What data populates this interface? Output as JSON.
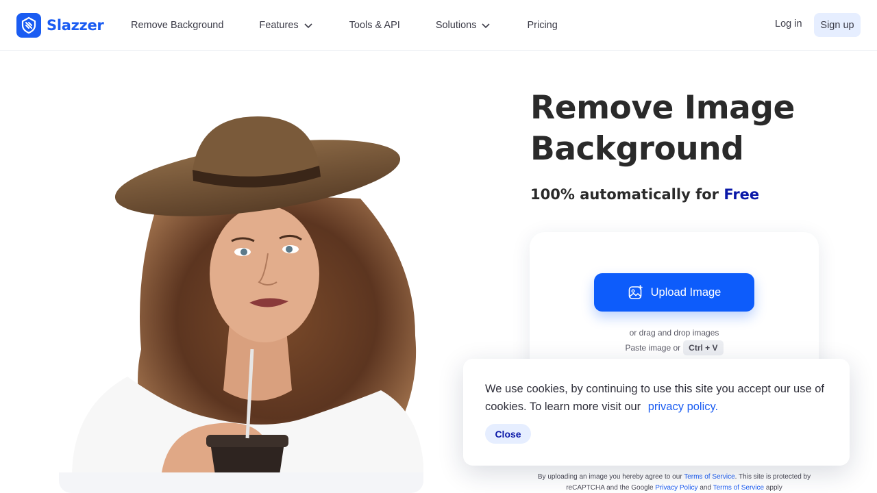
{
  "header": {
    "brand": "Slazzer",
    "nav": [
      {
        "label": "Remove Background",
        "dropdown": false
      },
      {
        "label": "Features",
        "dropdown": true
      },
      {
        "label": "Tools & API",
        "dropdown": false
      },
      {
        "label": "Solutions",
        "dropdown": true
      },
      {
        "label": "Pricing",
        "dropdown": false
      }
    ],
    "login_label": "Log in",
    "signup_label": "Sign up"
  },
  "hero": {
    "title_line1": "Remove Image",
    "title_line2": "Background",
    "subtitle_prefix": "100% automatically for",
    "subtitle_accent": "Free"
  },
  "upload": {
    "button_label": "Upload Image",
    "drag_text": "or drag and drop images",
    "paste_text": "Paste image or",
    "paste_shortcut": "Ctrl + V"
  },
  "legal": {
    "part1": "By uploading an image you hereby agree to our",
    "terms_link": "Terms of Service",
    "part2": ". This site is protected by reCAPTCHA and the Google",
    "privacy_link": "Privacy Policy",
    "part3": "and",
    "terms_link2": "Terms of Service",
    "part4": "apply"
  },
  "cookie": {
    "message": "We use cookies, by continuing to use this site you accept our use of cookies.  To learn more visit our",
    "link_label": "privacy policy.",
    "close_label": "Close"
  },
  "colors": {
    "brand": "#1a5cf2",
    "upload_button": "#0d5cfb",
    "accent_text": "#0a18a8",
    "soft_button_bg": "#e6eeff"
  },
  "icons": [
    "logo-mark",
    "chevron-down-icon",
    "image-upload-icon"
  ]
}
